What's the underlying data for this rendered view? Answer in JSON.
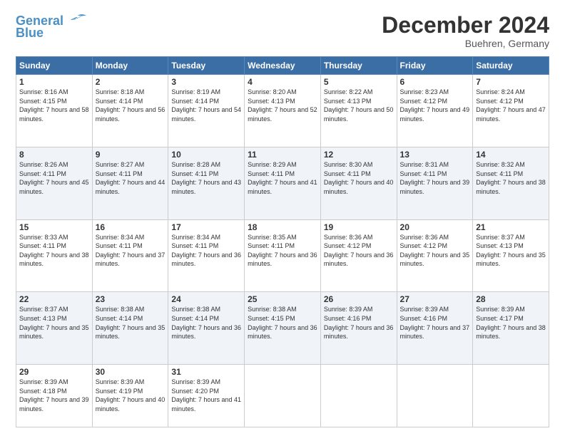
{
  "header": {
    "logo_line1": "General",
    "logo_line2": "Blue",
    "month": "December 2024",
    "location": "Buehren, Germany"
  },
  "days_of_week": [
    "Sunday",
    "Monday",
    "Tuesday",
    "Wednesday",
    "Thursday",
    "Friday",
    "Saturday"
  ],
  "weeks": [
    [
      {
        "day": "1",
        "sunrise": "Sunrise: 8:16 AM",
        "sunset": "Sunset: 4:15 PM",
        "daylight": "Daylight: 7 hours and 58 minutes."
      },
      {
        "day": "2",
        "sunrise": "Sunrise: 8:18 AM",
        "sunset": "Sunset: 4:14 PM",
        "daylight": "Daylight: 7 hours and 56 minutes."
      },
      {
        "day": "3",
        "sunrise": "Sunrise: 8:19 AM",
        "sunset": "Sunset: 4:14 PM",
        "daylight": "Daylight: 7 hours and 54 minutes."
      },
      {
        "day": "4",
        "sunrise": "Sunrise: 8:20 AM",
        "sunset": "Sunset: 4:13 PM",
        "daylight": "Daylight: 7 hours and 52 minutes."
      },
      {
        "day": "5",
        "sunrise": "Sunrise: 8:22 AM",
        "sunset": "Sunset: 4:13 PM",
        "daylight": "Daylight: 7 hours and 50 minutes."
      },
      {
        "day": "6",
        "sunrise": "Sunrise: 8:23 AM",
        "sunset": "Sunset: 4:12 PM",
        "daylight": "Daylight: 7 hours and 49 minutes."
      },
      {
        "day": "7",
        "sunrise": "Sunrise: 8:24 AM",
        "sunset": "Sunset: 4:12 PM",
        "daylight": "Daylight: 7 hours and 47 minutes."
      }
    ],
    [
      {
        "day": "8",
        "sunrise": "Sunrise: 8:26 AM",
        "sunset": "Sunset: 4:11 PM",
        "daylight": "Daylight: 7 hours and 45 minutes."
      },
      {
        "day": "9",
        "sunrise": "Sunrise: 8:27 AM",
        "sunset": "Sunset: 4:11 PM",
        "daylight": "Daylight: 7 hours and 44 minutes."
      },
      {
        "day": "10",
        "sunrise": "Sunrise: 8:28 AM",
        "sunset": "Sunset: 4:11 PM",
        "daylight": "Daylight: 7 hours and 43 minutes."
      },
      {
        "day": "11",
        "sunrise": "Sunrise: 8:29 AM",
        "sunset": "Sunset: 4:11 PM",
        "daylight": "Daylight: 7 hours and 41 minutes."
      },
      {
        "day": "12",
        "sunrise": "Sunrise: 8:30 AM",
        "sunset": "Sunset: 4:11 PM",
        "daylight": "Daylight: 7 hours and 40 minutes."
      },
      {
        "day": "13",
        "sunrise": "Sunrise: 8:31 AM",
        "sunset": "Sunset: 4:11 PM",
        "daylight": "Daylight: 7 hours and 39 minutes."
      },
      {
        "day": "14",
        "sunrise": "Sunrise: 8:32 AM",
        "sunset": "Sunset: 4:11 PM",
        "daylight": "Daylight: 7 hours and 38 minutes."
      }
    ],
    [
      {
        "day": "15",
        "sunrise": "Sunrise: 8:33 AM",
        "sunset": "Sunset: 4:11 PM",
        "daylight": "Daylight: 7 hours and 38 minutes."
      },
      {
        "day": "16",
        "sunrise": "Sunrise: 8:34 AM",
        "sunset": "Sunset: 4:11 PM",
        "daylight": "Daylight: 7 hours and 37 minutes."
      },
      {
        "day": "17",
        "sunrise": "Sunrise: 8:34 AM",
        "sunset": "Sunset: 4:11 PM",
        "daylight": "Daylight: 7 hours and 36 minutes."
      },
      {
        "day": "18",
        "sunrise": "Sunrise: 8:35 AM",
        "sunset": "Sunset: 4:11 PM",
        "daylight": "Daylight: 7 hours and 36 minutes."
      },
      {
        "day": "19",
        "sunrise": "Sunrise: 8:36 AM",
        "sunset": "Sunset: 4:12 PM",
        "daylight": "Daylight: 7 hours and 36 minutes."
      },
      {
        "day": "20",
        "sunrise": "Sunrise: 8:36 AM",
        "sunset": "Sunset: 4:12 PM",
        "daylight": "Daylight: 7 hours and 35 minutes."
      },
      {
        "day": "21",
        "sunrise": "Sunrise: 8:37 AM",
        "sunset": "Sunset: 4:13 PM",
        "daylight": "Daylight: 7 hours and 35 minutes."
      }
    ],
    [
      {
        "day": "22",
        "sunrise": "Sunrise: 8:37 AM",
        "sunset": "Sunset: 4:13 PM",
        "daylight": "Daylight: 7 hours and 35 minutes."
      },
      {
        "day": "23",
        "sunrise": "Sunrise: 8:38 AM",
        "sunset": "Sunset: 4:14 PM",
        "daylight": "Daylight: 7 hours and 35 minutes."
      },
      {
        "day": "24",
        "sunrise": "Sunrise: 8:38 AM",
        "sunset": "Sunset: 4:14 PM",
        "daylight": "Daylight: 7 hours and 36 minutes."
      },
      {
        "day": "25",
        "sunrise": "Sunrise: 8:38 AM",
        "sunset": "Sunset: 4:15 PM",
        "daylight": "Daylight: 7 hours and 36 minutes."
      },
      {
        "day": "26",
        "sunrise": "Sunrise: 8:39 AM",
        "sunset": "Sunset: 4:16 PM",
        "daylight": "Daylight: 7 hours and 36 minutes."
      },
      {
        "day": "27",
        "sunrise": "Sunrise: 8:39 AM",
        "sunset": "Sunset: 4:16 PM",
        "daylight": "Daylight: 7 hours and 37 minutes."
      },
      {
        "day": "28",
        "sunrise": "Sunrise: 8:39 AM",
        "sunset": "Sunset: 4:17 PM",
        "daylight": "Daylight: 7 hours and 38 minutes."
      }
    ],
    [
      {
        "day": "29",
        "sunrise": "Sunrise: 8:39 AM",
        "sunset": "Sunset: 4:18 PM",
        "daylight": "Daylight: 7 hours and 39 minutes."
      },
      {
        "day": "30",
        "sunrise": "Sunrise: 8:39 AM",
        "sunset": "Sunset: 4:19 PM",
        "daylight": "Daylight: 7 hours and 40 minutes."
      },
      {
        "day": "31",
        "sunrise": "Sunrise: 8:39 AM",
        "sunset": "Sunset: 4:20 PM",
        "daylight": "Daylight: 7 hours and 41 minutes."
      },
      null,
      null,
      null,
      null
    ]
  ]
}
